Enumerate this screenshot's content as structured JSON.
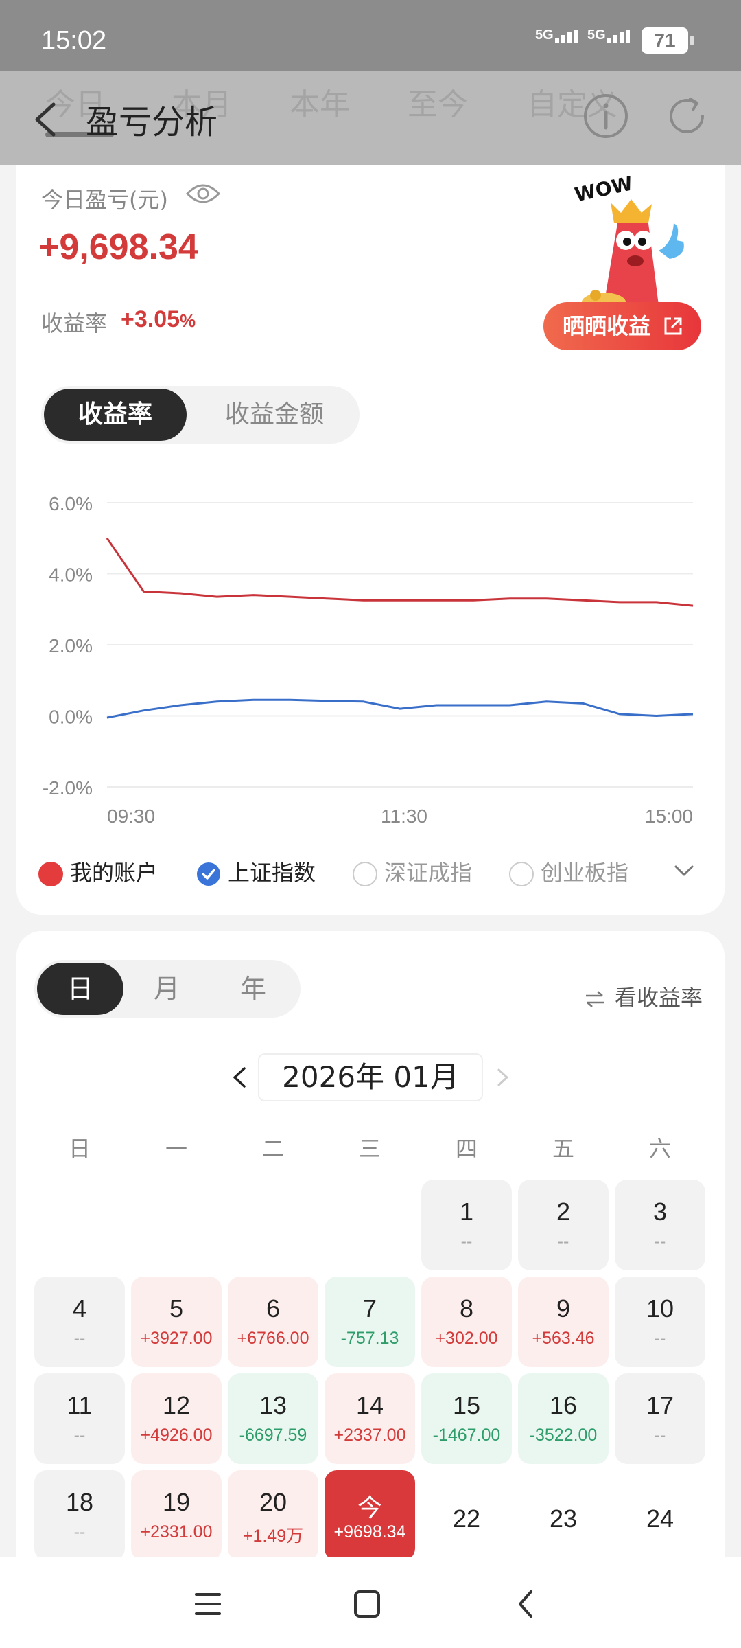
{
  "status_bar": {
    "time": "15:02",
    "signal1": "5G",
    "signal2": "5G",
    "battery": "71"
  },
  "header": {
    "title": "盈亏分析",
    "tabs": [
      "今日",
      "本月",
      "本年",
      "至今",
      "自定义"
    ]
  },
  "summary": {
    "pl_label": "今日盈亏(元)",
    "pl_value": "+9,698.34",
    "rate_label": "收益率",
    "rate_value": "+3.05",
    "rate_unit": "%",
    "mascot_text": "WOW",
    "share_label": "晒晒收益"
  },
  "chart_toggle": {
    "active": "收益率",
    "inactive": "收益金额"
  },
  "chart_data": {
    "type": "line",
    "x_ticks": [
      "09:30",
      "11:30",
      "15:00"
    ],
    "y_ticks": [
      "6.0%",
      "4.0%",
      "2.0%",
      "0.0%",
      "-2.0%"
    ],
    "ylim": [
      -2.0,
      6.0
    ],
    "x": [
      "09:30",
      "09:45",
      "10:00",
      "10:15",
      "10:30",
      "10:45",
      "11:00",
      "11:15",
      "11:30",
      "13:15",
      "13:30",
      "13:45",
      "14:00",
      "14:15",
      "14:30",
      "14:45",
      "15:00"
    ],
    "series": [
      {
        "name": "我的账户",
        "color": "#c9343a",
        "values": [
          5.0,
          3.5,
          3.45,
          3.35,
          3.4,
          3.35,
          3.3,
          3.25,
          3.25,
          3.25,
          3.25,
          3.3,
          3.3,
          3.25,
          3.2,
          3.2,
          3.1
        ]
      },
      {
        "name": "上证指数",
        "color": "#3a6fc9",
        "values": [
          -0.05,
          0.15,
          0.3,
          0.4,
          0.45,
          0.45,
          0.42,
          0.4,
          0.2,
          0.3,
          0.3,
          0.3,
          0.4,
          0.35,
          0.05,
          0.0,
          0.05
        ]
      }
    ],
    "grid": true
  },
  "legend": [
    {
      "label": "我的账户",
      "state": "on",
      "color": "#e43c3c"
    },
    {
      "label": "上证指数",
      "state": "checked",
      "color": "#3a74d9"
    },
    {
      "label": "深证成指",
      "state": "off"
    },
    {
      "label": "创业板指",
      "state": "off"
    }
  ],
  "calendar": {
    "period_tabs": [
      "日",
      "月",
      "年"
    ],
    "view_rate": "看收益率",
    "month_label": "2026年  01月",
    "weekdays": [
      "日",
      "一",
      "二",
      "三",
      "四",
      "五",
      "六"
    ],
    "days": [
      {
        "n": "1",
        "v": "--",
        "t": "gray",
        "col": 4,
        "row": 0
      },
      {
        "n": "2",
        "v": "--",
        "t": "gray",
        "col": 5,
        "row": 0
      },
      {
        "n": "3",
        "v": "--",
        "t": "gray",
        "col": 6,
        "row": 0
      },
      {
        "n": "4",
        "v": "--",
        "t": "gray",
        "col": 0,
        "row": 1
      },
      {
        "n": "5",
        "v": "+3927.00",
        "t": "red",
        "col": 1,
        "row": 1
      },
      {
        "n": "6",
        "v": "+6766.00",
        "t": "red",
        "col": 2,
        "row": 1
      },
      {
        "n": "7",
        "v": "-757.13",
        "t": "green",
        "col": 3,
        "row": 1
      },
      {
        "n": "8",
        "v": "+302.00",
        "t": "red",
        "col": 4,
        "row": 1
      },
      {
        "n": "9",
        "v": "+563.46",
        "t": "red",
        "col": 5,
        "row": 1
      },
      {
        "n": "10",
        "v": "--",
        "t": "gray",
        "col": 6,
        "row": 1
      },
      {
        "n": "11",
        "v": "--",
        "t": "gray",
        "col": 0,
        "row": 2
      },
      {
        "n": "12",
        "v": "+4926.00",
        "t": "red",
        "col": 1,
        "row": 2
      },
      {
        "n": "13",
        "v": "-6697.59",
        "t": "green",
        "col": 2,
        "row": 2
      },
      {
        "n": "14",
        "v": "+2337.00",
        "t": "red",
        "col": 3,
        "row": 2
      },
      {
        "n": "15",
        "v": "-1467.00",
        "t": "green",
        "col": 4,
        "row": 2
      },
      {
        "n": "16",
        "v": "-3522.00",
        "t": "green",
        "col": 5,
        "row": 2
      },
      {
        "n": "17",
        "v": "--",
        "t": "gray",
        "col": 6,
        "row": 2
      },
      {
        "n": "18",
        "v": "--",
        "t": "gray",
        "col": 0,
        "row": 3
      },
      {
        "n": "19",
        "v": "+2331.00",
        "t": "red",
        "col": 1,
        "row": 3
      },
      {
        "n": "20",
        "v": "+1.49万",
        "t": "red",
        "col": 2,
        "row": 3
      },
      {
        "n": "今",
        "v": "+9698.34",
        "t": "today",
        "col": 3,
        "row": 3
      },
      {
        "n": "22",
        "v": "",
        "t": "plain",
        "col": 4,
        "row": 3
      },
      {
        "n": "23",
        "v": "",
        "t": "plain",
        "col": 5,
        "row": 3
      },
      {
        "n": "24",
        "v": "",
        "t": "plain",
        "col": 6,
        "row": 3
      }
    ]
  },
  "colors": {
    "profit": "#d33a3a",
    "loss": "#2f9d6a",
    "accent_dark": "#2b2b2b"
  }
}
